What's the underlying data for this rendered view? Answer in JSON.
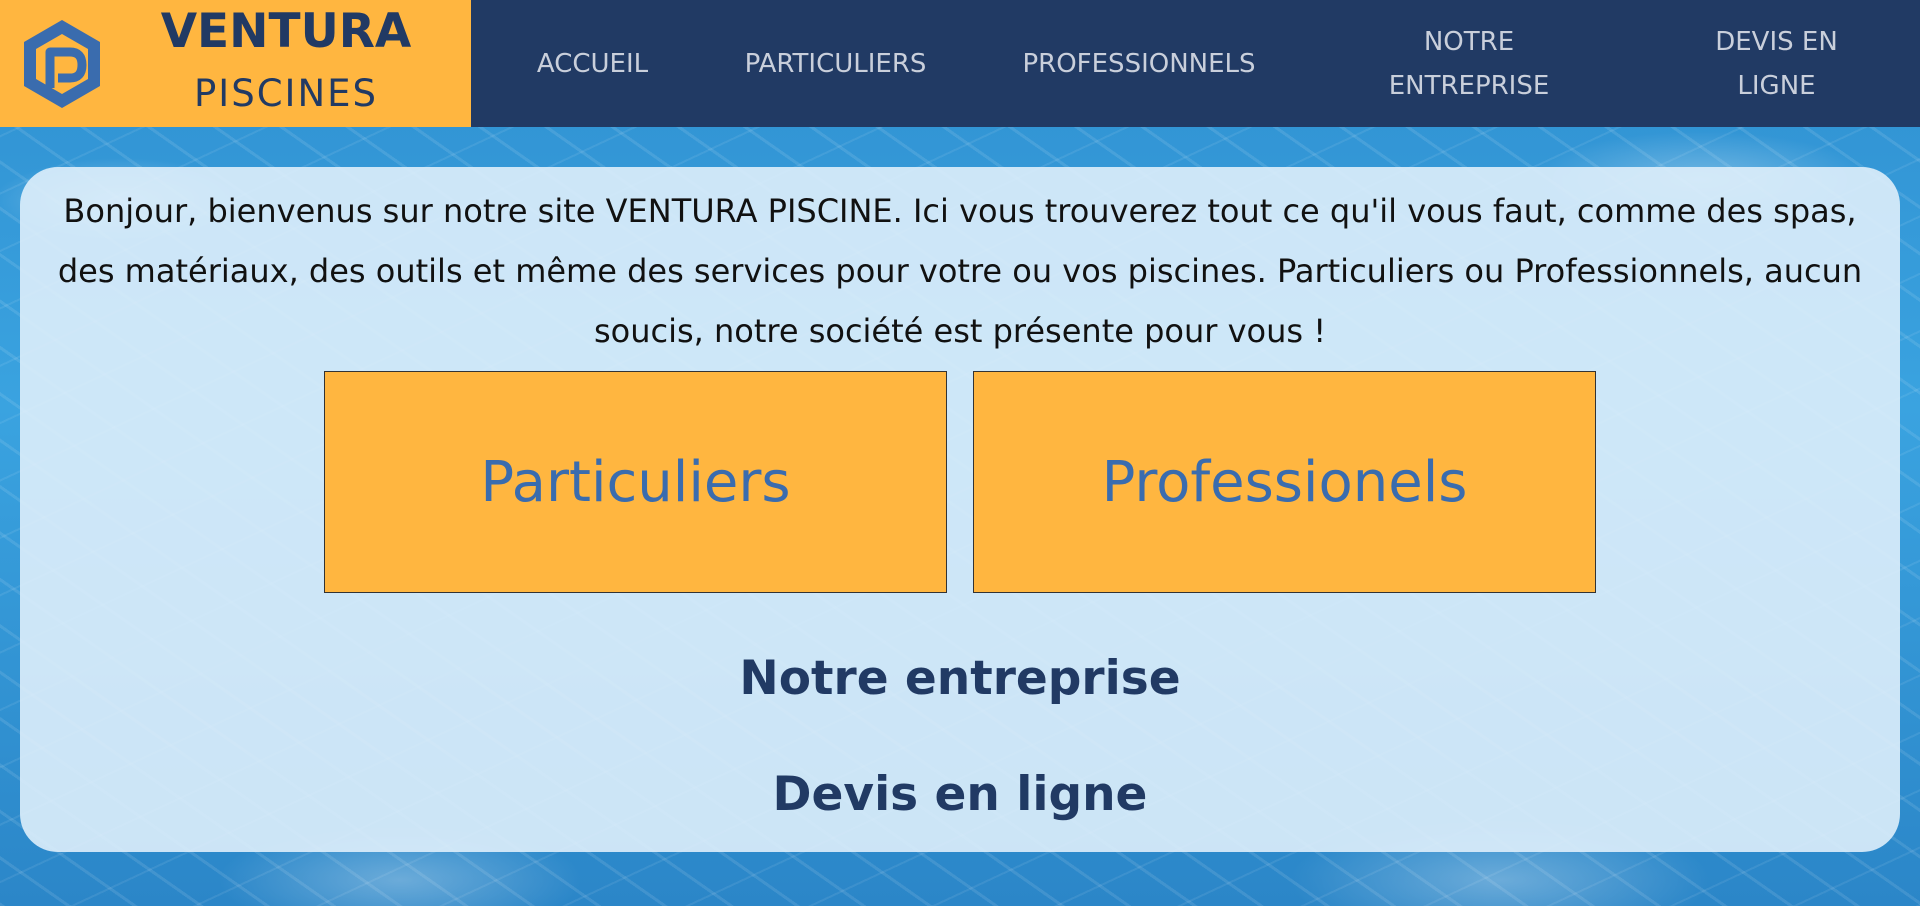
{
  "brand": {
    "title": "VENTURA",
    "subtitle": "PISCINES",
    "logo_icon": "hexagon-p-logo-icon"
  },
  "nav": {
    "items": [
      {
        "label": "ACCUEIL"
      },
      {
        "label": "PARTICULIERS"
      },
      {
        "label": "PROFESSIONNELS"
      },
      {
        "label_line1": "NOTRE",
        "label_line2": "ENTREPRISE"
      },
      {
        "label_line1": "DEVIS EN",
        "label_line2": "LIGNE"
      }
    ]
  },
  "main": {
    "intro_text": "Bonjour, bienvenus sur notre site VENTURA PISCINE. Ici vous trouverez tout ce qu'il vous faut, comme des spas, des matériaux, des outils et même des services pour votre ou vos piscines. Particuliers ou Professionnels, aucun soucis, notre société est présente pour vous !",
    "buttons": {
      "particuliers": "Particuliers",
      "professionels": "Professionels"
    },
    "links": {
      "entreprise": "Notre entreprise",
      "devis": "Devis en ligne"
    }
  },
  "colors": {
    "header_bg": "#213a64",
    "accent_orange": "#ffb640",
    "button_text_blue": "#3a6cae",
    "nav_text": "#c9cfdb"
  }
}
